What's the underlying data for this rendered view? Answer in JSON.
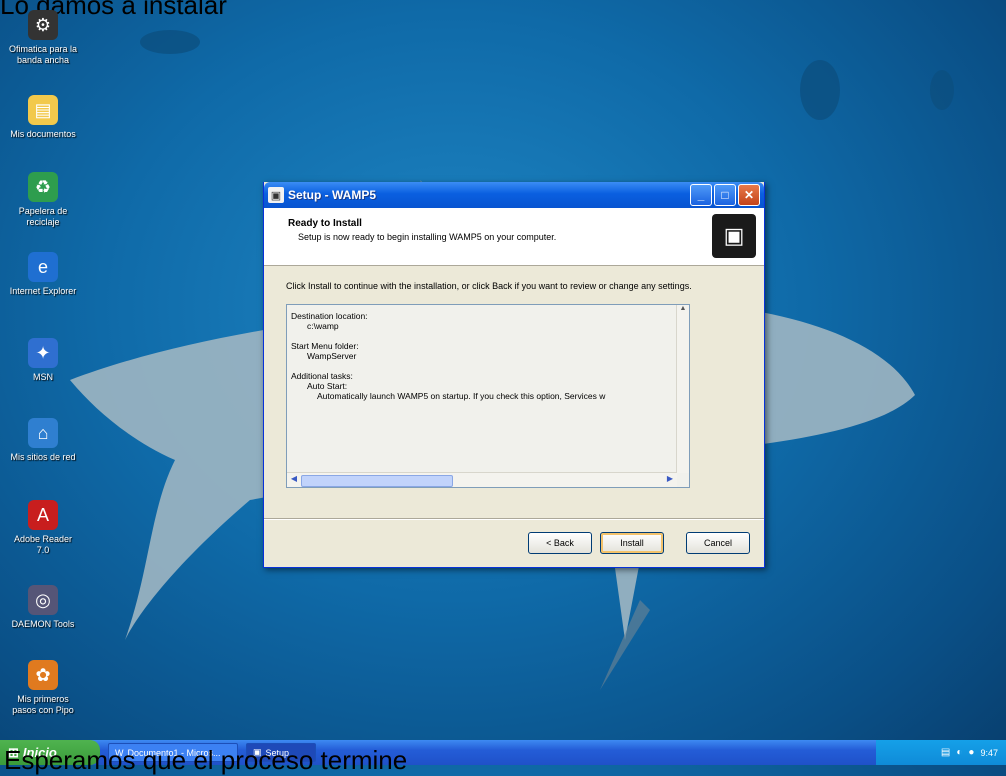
{
  "captions": {
    "top": "Lo damos a instalar",
    "bottom": "Esperamos que el proceso termine"
  },
  "desktop": {
    "icons": [
      {
        "name": "recycle-like-icon",
        "label": "Ofimatica para la banda ancha",
        "glyph": "⚙",
        "color": "#333333"
      },
      {
        "name": "my-documents-icon",
        "label": "Mis documentos",
        "glyph": "📁",
        "color": "#f2c94c"
      },
      {
        "name": "recycle-bin-icon",
        "label": "Papelera de reciclaje",
        "glyph": "♻",
        "color": "#2e9d4e"
      },
      {
        "name": "internet-explorer-icon",
        "label": "Internet Explorer",
        "glyph": "e",
        "color": "#1f6fd1"
      },
      {
        "name": "msn-icon",
        "label": "MSN",
        "glyph": "✦",
        "color": "#2f6fd0"
      },
      {
        "name": "network-places-icon",
        "label": "Mis sitios de red",
        "glyph": "⌂",
        "color": "#2f7fd0"
      },
      {
        "name": "adobe-reader-icon",
        "label": "Adobe Reader 7.0",
        "glyph": "A",
        "color": "#c81e1e"
      },
      {
        "name": "daemon-tools-icon",
        "label": "DAEMON Tools",
        "glyph": "◎",
        "color": "#555577"
      },
      {
        "name": "first-steps-icon",
        "label": "Mis primeros pasos con Pipo",
        "glyph": "✿",
        "color": "#e07a1f"
      }
    ]
  },
  "window": {
    "title": "Setup - WAMP5",
    "header": {
      "title": "Ready to Install",
      "subtitle": "Setup is now ready to begin installing WAMP5 on your computer."
    },
    "instructions": "Click Install to continue with the installation, or click Back if you want to review or change any settings.",
    "summary": {
      "dest_label": "Destination location:",
      "dest_value": "c:\\wamp",
      "menu_label": "Start Menu folder:",
      "menu_value": "WampServer",
      "tasks_label": "Additional tasks:",
      "tasks_group": "Auto Start:",
      "tasks_value": "Automatically launch WAMP5 on startup. If you check this option, Services w"
    },
    "buttons": {
      "back": "< Back",
      "install": "Install",
      "cancel": "Cancel"
    }
  },
  "taskbar": {
    "start": "Inicio",
    "items": [
      {
        "label": "Documento1 - Micros..."
      },
      {
        "label": "Setup"
      }
    ],
    "clock": "9:47"
  }
}
